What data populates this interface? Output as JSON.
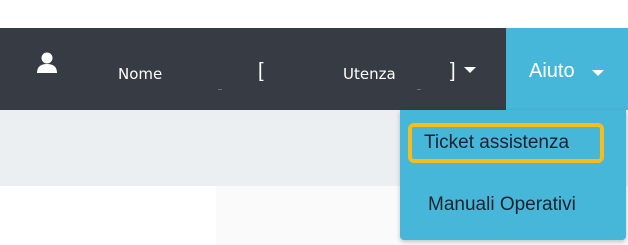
{
  "navbar": {
    "user_menu": {
      "name": "Nome",
      "bracket_open": "[",
      "role": "Utenza",
      "bracket_close": "]"
    },
    "help_menu": {
      "label": "Aiuto"
    }
  },
  "dropdown": {
    "items": [
      {
        "label": "Ticket assistenza",
        "highlighted": true
      },
      {
        "label": "Manuali Operativi"
      }
    ]
  },
  "colors": {
    "navbar_background": "#373b44",
    "help_menu_background": "#46b7d8",
    "highlight_outline": "#f7bd19",
    "page_band": "#eceff1"
  },
  "icons": {
    "user": "user-icon",
    "user_dropdown": "caret-down-icon",
    "help_dropdown": "caret-down-icon"
  }
}
